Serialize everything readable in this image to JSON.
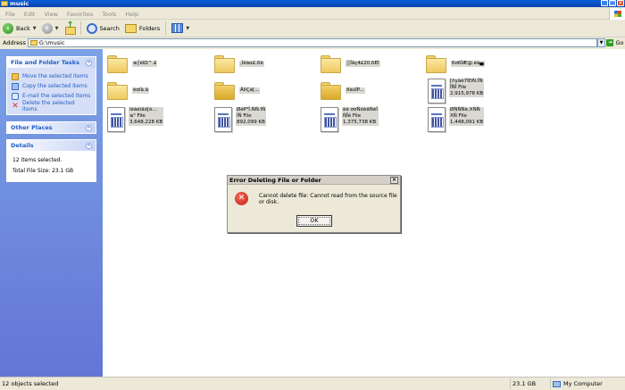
{
  "window": {
    "title": "music"
  },
  "menu": [
    "File",
    "Edit",
    "View",
    "Favorites",
    "Tools",
    "Help"
  ],
  "toolbar": {
    "back": "Back",
    "search": "Search",
    "folders": "Folders"
  },
  "address": {
    "label": "Address",
    "path": "G:\\music",
    "go": "Go"
  },
  "left": {
    "tasks_title": "File and Folder Tasks",
    "tasks": [
      "Move the selected items",
      "Copy the selected items",
      "E-mail the selected items",
      "Delete the selected items"
    ],
    "other_title": "Other Places",
    "details_title": "Details",
    "details_line1": "12 items selected.",
    "details_line2": "Total File Size: 23.1 GB"
  },
  "folders": [
    "≤⌠éîΩ^.£",
    ",Ìêàα£.ßè",
    "░Ïâç4£20.ßEÍ",
    "ßσßÏÆ@.èà▄",
    "èαîà.ä",
    "ÂíìÇà[...",
    "ðàúÍP..."
  ],
  "files": [
    {
      "name": "[ñyàè7ÌÐÑ.ÎÑ",
      "type": "ÎÑÎ File",
      "size": "2,915,978 KB"
    },
    {
      "name": "ìèàèìâó[è...",
      "type": "≤² File",
      "size": "3,648,228 KB"
    },
    {
      "name": "ØéP³Î.ÑÑ.îÑ",
      "type": "îÑ File",
      "size": "892,099 KB"
    },
    {
      "name": "èé σσÑóèâÑèÎ",
      "type": "ÑÎè File",
      "size": "1,375,738 KB"
    },
    {
      "name": "ØÑÑÑè.XÑÑ",
      "type": "XÑ File",
      "size": "1,448,091 KB"
    }
  ],
  "dialog": {
    "title": "Error Deleting File or Folder",
    "message": "Cannot delete file: Cannot read from the source file or disk.",
    "ok": "OK"
  },
  "status": {
    "objects": "12 objects selected",
    "size": "23.1 GB",
    "location": "My Computer"
  }
}
